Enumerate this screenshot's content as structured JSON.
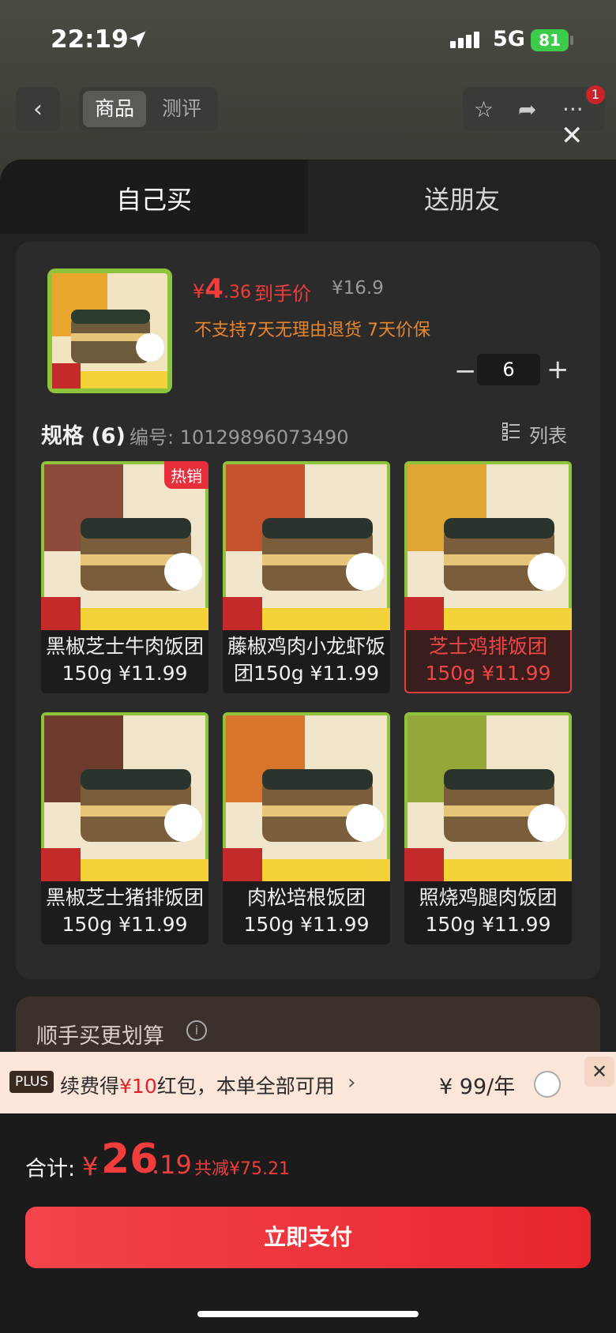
{
  "status_bar": {
    "time": "22:19",
    "network": "5G",
    "battery": "81"
  },
  "header": {
    "tabs": [
      "商品",
      "测评"
    ],
    "notification_count": "1"
  },
  "sheet_tabs": {
    "self": "自己买",
    "gift": "送朋友"
  },
  "product": {
    "price_currency": "¥",
    "price_int": "4",
    "price_dec": ".36",
    "price_label": "到手价",
    "original_price": "¥16.9",
    "policy": "不支持7天无理由退货  7天价保",
    "quantity": "6"
  },
  "spec": {
    "title": "规格 (6)",
    "code": "编号: 10129896073490",
    "list_label": "列表"
  },
  "skus": [
    {
      "name": "黑椒芝士牛肉饭团150g ¥11.99",
      "hot": "热销",
      "selected": false,
      "color": "#8b4a3a"
    },
    {
      "name": "藤椒鸡肉小龙虾饭团150g ¥11.99",
      "selected": false,
      "color": "#c7532e"
    },
    {
      "name": "芝士鸡排饭团150g ¥11.99",
      "selected": true,
      "color": "#e0a532"
    },
    {
      "name": "黑椒芝士猪排饭团150g ¥11.99",
      "selected": false,
      "color": "#6e3c2e"
    },
    {
      "name": "肉松培根饭团150g ¥11.99",
      "selected": false,
      "color": "#d8742c"
    },
    {
      "name": "照烧鸡腿肉饭团150g ¥11.99",
      "selected": false,
      "color": "#94a83a"
    }
  ],
  "addon": {
    "title": "顺手买更划算"
  },
  "plus_bar": {
    "tag": "PLUS",
    "text_before": "续费得",
    "text_red": "¥10",
    "text_after": "红包，本单全部可用",
    "price": "¥ 99/年"
  },
  "footer": {
    "total_label": "合计:",
    "total_currency": "¥",
    "total_int": "26",
    "total_dec": ".19",
    "discount": "共减¥75.21",
    "pay_label": "立即支付"
  },
  "colors": {
    "accent": "#f23d3d",
    "pay_button": "#e8262e",
    "policy": "#e8862e"
  }
}
